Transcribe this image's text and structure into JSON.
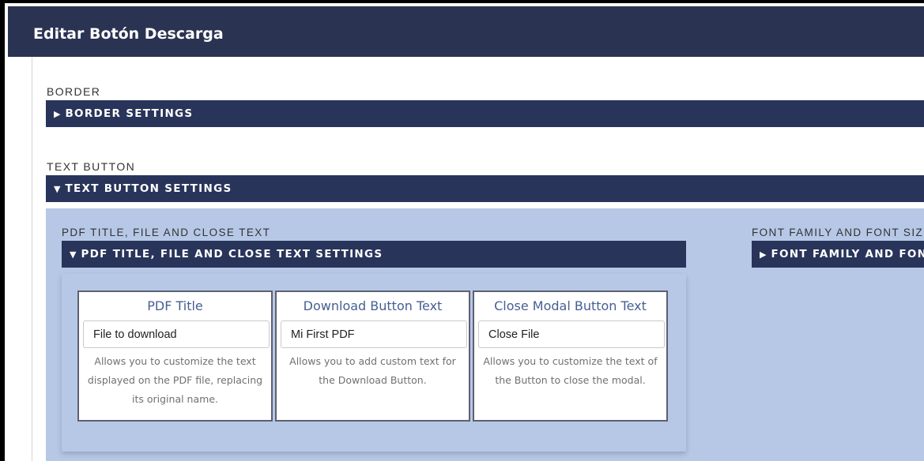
{
  "header": {
    "title": "Editar Botón Descarga"
  },
  "border": {
    "label": "BORDER",
    "bar_label": "BORDER SETTINGS",
    "bar_icon": "triangle-right-icon"
  },
  "text_button": {
    "label": "TEXT BUTTON",
    "bar_label": "TEXT BUTTON SETTINGS",
    "bar_icon": "triangle-down-icon"
  },
  "pdf_section": {
    "label": "PDF TITLE, FILE AND CLOSE TEXT",
    "bar_label": "PDF TITLE, FILE AND CLOSE TEXT SETTINGS",
    "bar_icon": "triangle-down-icon"
  },
  "font_section": {
    "label": "FONT FAMILY AND FONT SIZ",
    "bar_label": "FONT FAMILY AND FONT",
    "bar_icon": "triangle-right-icon"
  },
  "cards": [
    {
      "title": "PDF Title",
      "value": "File to download",
      "help": "Allows you to customize the text displayed on the PDF file, replacing its original name."
    },
    {
      "title": "Download Button Text",
      "value": "Mi First PDF",
      "help": "Allows you to add custom text for the Download Button."
    },
    {
      "title": "Close Modal Button Text",
      "value": "Close File",
      "help": "Allows you to customize the text of the Button to close the modal."
    }
  ],
  "colors": {
    "header_bg": "#2a3352",
    "bar_bg": "#29345a",
    "panel_bg": "#b6c8e6",
    "card_title": "#465f94"
  }
}
